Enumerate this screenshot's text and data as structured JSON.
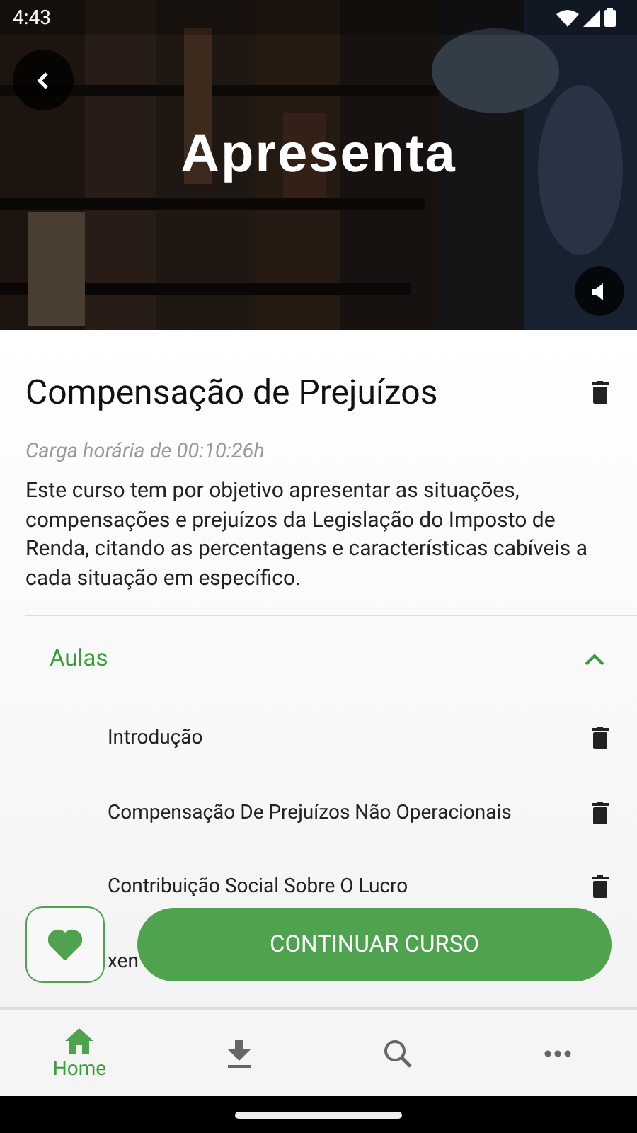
{
  "status_bar": {
    "time": "4:43"
  },
  "video": {
    "title": "Apresenta",
    "muted": true
  },
  "course": {
    "title": "Compensação de Prejuízos",
    "workload": "Carga horária de 00:10:26h",
    "description": "Este curso tem por objetivo apresentar as situações, compensações e prejuízos da Legislação do Imposto de Renda, citando as percentagens e características cabíveis a cada situação em específico."
  },
  "lessons_section": {
    "title": "Aulas",
    "expanded": true,
    "lessons": [
      {
        "title": "Introdução",
        "trash_visible": true
      },
      {
        "title": "Compensação De Prejuízos Não Operacionais",
        "trash_visible": true
      },
      {
        "title": "Contribuição Social Sobre O Lucro",
        "trash_visible": true
      },
      {
        "title": "xen",
        "trash_visible": false
      }
    ]
  },
  "favorite": {
    "on": true
  },
  "continue_button": {
    "label": "CONTINUAR CURSO"
  },
  "bottom_nav": [
    {
      "kind": "home",
      "label": "Home",
      "selected": true
    },
    {
      "kind": "download",
      "selected": false
    },
    {
      "kind": "search",
      "selected": false
    },
    {
      "kind": "more",
      "selected": false
    }
  ]
}
